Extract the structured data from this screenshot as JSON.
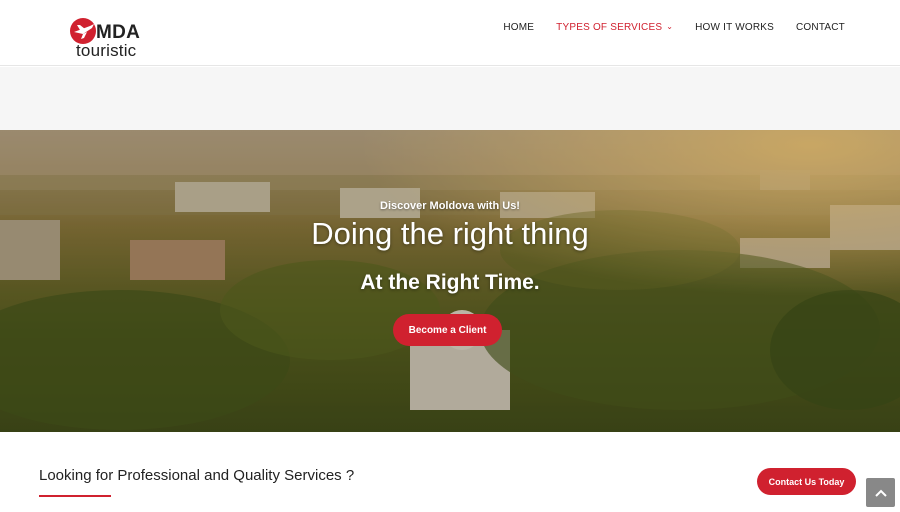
{
  "brand": {
    "line1": "MDA",
    "line2": "touristic",
    "logo_icon": "plane-globe-icon",
    "accent": "#d0212f"
  },
  "nav": {
    "items": [
      {
        "label": "HOME"
      },
      {
        "label": "TYPES OF SERVICES",
        "icon": "chevron-down-icon"
      },
      {
        "label": "HOW IT WORKS"
      },
      {
        "label": "CONTACT"
      }
    ]
  },
  "hero": {
    "subtitle": "Discover Moldova with Us!",
    "title": "Doing the right thing",
    "tagline": "At the Right Time.",
    "button": "Become a Client"
  },
  "section": {
    "heading": "Looking for Professional and Quality Services ?",
    "contact_button": "Contact Us Today",
    "scroll_top_icon": "chevron-up-icon"
  }
}
